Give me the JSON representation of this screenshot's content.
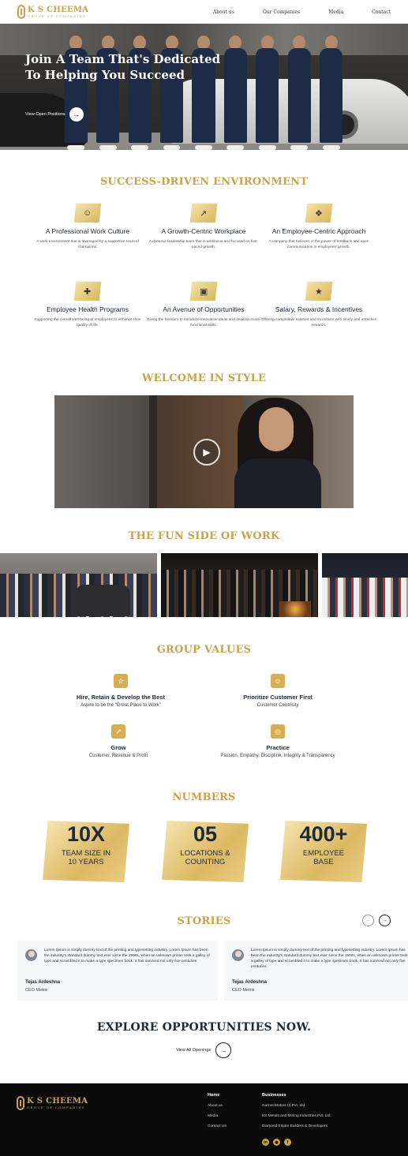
{
  "nav": {
    "logo_name": "K S CHEEMA",
    "logo_sub": "GROUP OF COMPANIES",
    "items": [
      "About us",
      "Our Companies",
      "Media",
      "Contact"
    ]
  },
  "hero": {
    "title": "Join A Team That's Dedicated To Helping You Succeed",
    "cta": "View Open Positions"
  },
  "environment": {
    "title": "SUCCESS-DRIVEN ENVIRONMENT",
    "features": [
      {
        "icon": "team-icon",
        "title": "A Professional Work Culture",
        "desc": "A work environment that is leveraged by a supportive team of champions."
      },
      {
        "icon": "growth-chart-icon",
        "title": "A Growth-Centric Workplace",
        "desc": "A dynamic leadership team that is ambitious and focused on fast-paced growth."
      },
      {
        "icon": "network-icon",
        "title": "An Employee-Centric Approach",
        "desc": "A company that believes in the power of feedback and open communication in employees' growth."
      },
      {
        "icon": "health-shield-icon",
        "title": "Employee Health Programs",
        "desc": "Supporting the overall well-being of employees to enhance their quality of life."
      },
      {
        "icon": "briefcase-icon",
        "title": "An Avenue of Opportunities",
        "desc": "Giving the freedom to introduce innovative ideas and develop cross-functional skills."
      },
      {
        "icon": "reward-icon",
        "title": "Salary, Rewards & Incentives",
        "desc": "Offering competitive salaries and incentives with timely and attractive rewards."
      }
    ]
  },
  "welcome": {
    "title": "WELCOME IN STYLE"
  },
  "fun": {
    "title": "THE FUN SIDE OF WORK"
  },
  "values": {
    "title": "GROUP VALUES",
    "items": [
      {
        "icon": "award-icon",
        "title": "Hire, Retain & Develop the Best",
        "sub": "Aspire to be the \"Great Place to Work\""
      },
      {
        "icon": "smile-icon",
        "title": "Prioritize Customer First",
        "sub": "Customer Centricity"
      },
      {
        "icon": "growth-icon",
        "title": "Grow",
        "sub": "Customer, Revenue & Profit"
      },
      {
        "icon": "target-icon",
        "title": "Practice",
        "sub": "Passion, Empathy, Discipline, Integrity & Transparency"
      }
    ]
  },
  "numbers": {
    "title": "NUMBERS",
    "items": [
      {
        "value": "10X",
        "label1": "TEAM SIZE IN",
        "label2": "10 YEARS"
      },
      {
        "value": "05",
        "label1": "LOCATIONS &",
        "label2": "COUNTING"
      },
      {
        "value": "400+",
        "label1": "EMPLOYEE",
        "label2": "BASE"
      }
    ]
  },
  "stories": {
    "title": "STORIES",
    "items": [
      {
        "text": "Lorem Ipsum is simply dummy text of the printing and typesetting industry. Lorem Ipsum has been the industry's standard dummy text ever since the 1500s, when an unknown printer took a galley of type and scrambled it to make a type specimen book. It has survived not only five centuries",
        "name": "Tejas Ardeshna",
        "role": "CEO Metrix"
      },
      {
        "text": "Lorem Ipsum is simply dummy text of the printing and typesetting industry. Lorem Ipsum has been the industry's standard dummy text ever since the 1500s, when an unknown printer took a galley of type and scrambled it to make a type specimen book. It has survived not only five centuries",
        "name": "Tejas Ardeshna",
        "role": "CEO Metrix"
      }
    ]
  },
  "explore": {
    "title": "EXPLORE OPPORTUNITIES NOW.",
    "cta": "View All Openings"
  },
  "footer": {
    "logo_name": "K S CHEEMA",
    "logo_sub": "GROUP OF COMPANIES",
    "home_heading": "Home",
    "home_links": [
      "About us",
      "Media",
      "Contact Us"
    ],
    "biz_heading": "Businesses",
    "biz_links": [
      "Garnet Motors (I) Pvt. Ltd.",
      "KS Metals and Mining Industries Pvt. Ltd.",
      "Diamond Estate Builders & Developers"
    ],
    "social": [
      "linkedin-icon",
      "instagram-icon",
      "facebook-icon"
    ]
  },
  "colors": {
    "accent": "#c9a24c",
    "navy": "#1d2a3a"
  }
}
